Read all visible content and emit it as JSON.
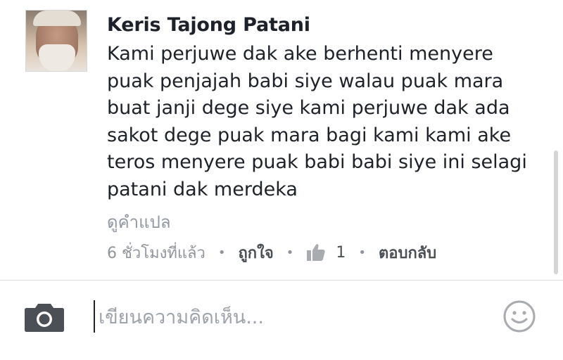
{
  "comment": {
    "author": "Keris Tajong Patani",
    "text_lines": [
      "Kami perjuwe dak ake berhenti menyere",
      "puak penjajah babi siye walau puak mara",
      "buat janji dege siye kami perjuwe dak ada",
      "sakot dege puak mara bagi kami kami ake",
      "teros menyere puak babi babi siye ini selagi",
      "patani dak merdeka"
    ],
    "see_translation": "ดูคำแปล",
    "timestamp": "6 ชั่วโมงที่แล้ว",
    "like_label": "ถูกใจ",
    "like_count": "1",
    "reply_label": "ตอบกลับ",
    "separator": "•"
  },
  "composer": {
    "placeholder": "เขียนความคิดเห็น...",
    "value": ""
  },
  "icons": {
    "camera": "camera-icon",
    "like": "thumbs-up-icon",
    "emoji": "smiley-icon"
  },
  "colors": {
    "text": "#1d2129",
    "secondary": "#90949c",
    "icon_gray": "#a8abaf",
    "camera_dark": "#4b4f56"
  }
}
